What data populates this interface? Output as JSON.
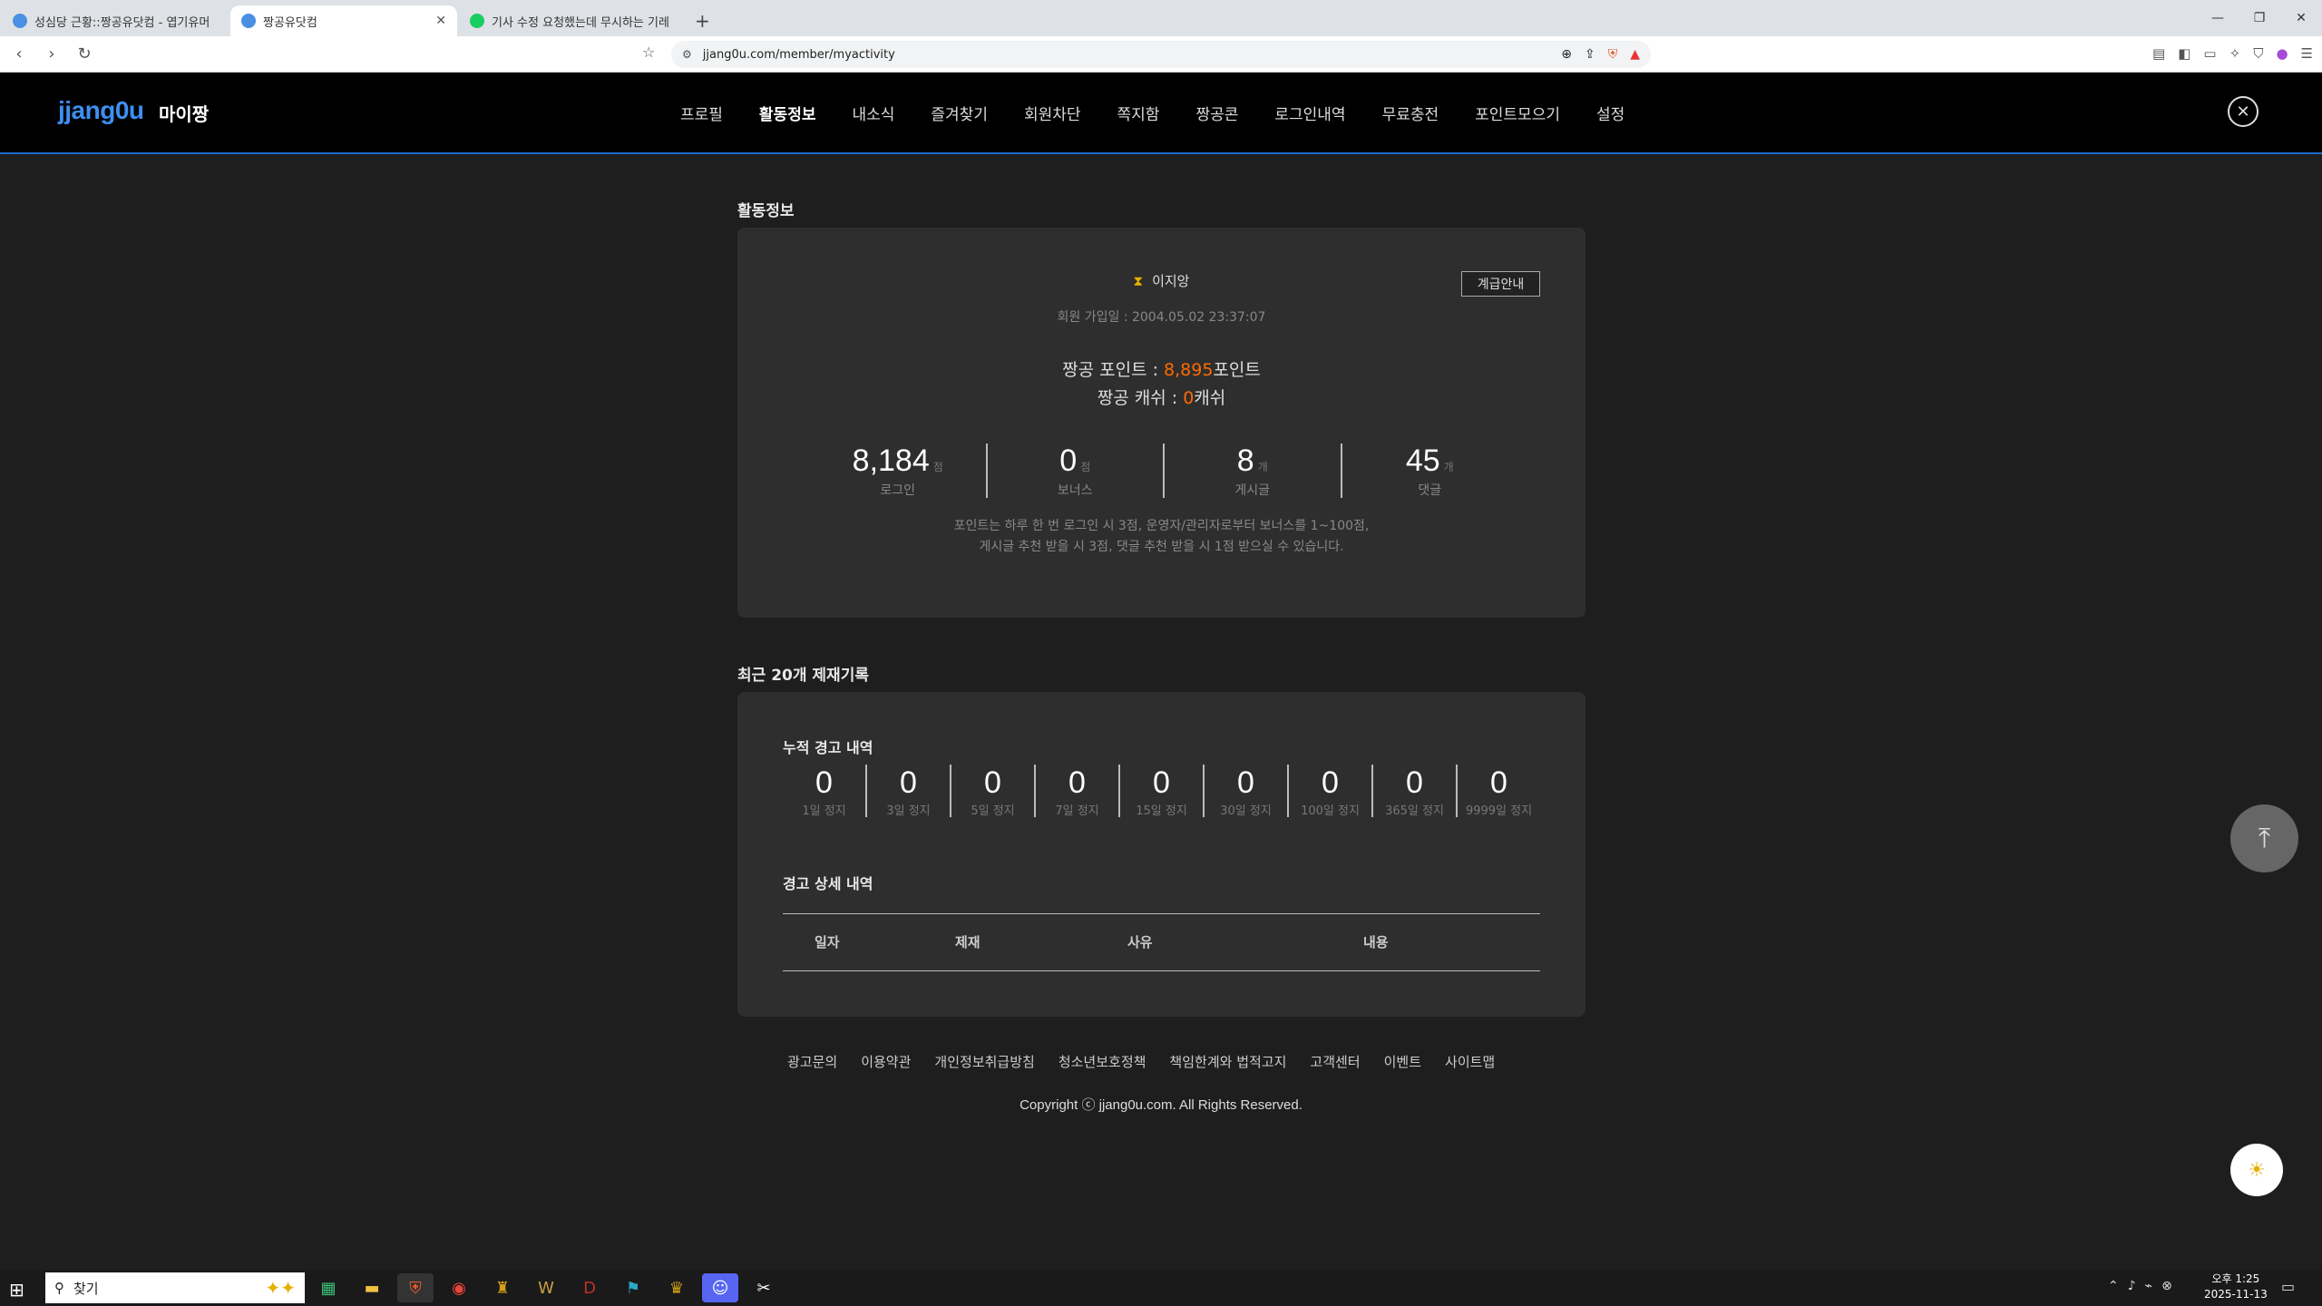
{
  "browser": {
    "tabs": [
      {
        "title": "성심당 근황::짱공유닷컴 - 엽기유머",
        "color": "#4a90e2"
      },
      {
        "title": "짱공유닷컴",
        "color": "#4a90e2"
      },
      {
        "title": "기사 수정 요청했는데 무시하는 기레",
        "color": "#19ce60"
      }
    ],
    "url": "jjang0u.com/member/myactivity"
  },
  "header": {
    "logo": "jjang0u",
    "logo_sub": "마이짱",
    "nav": [
      "프로필",
      "활동정보",
      "내소식",
      "즐겨찾기",
      "회원차단",
      "쪽지함",
      "짱공콘",
      "로그인내역",
      "무료충전",
      "포인트모으기",
      "설정"
    ],
    "active_nav": "활동정보"
  },
  "activity": {
    "section_title": "활동정보",
    "username": "이지앙",
    "grade_button": "계급안내",
    "joined_label": "회원 가입일 : 2004.05.02 23:37:07",
    "points_prefix": "짱공 포인트 : ",
    "points_value": "8,895",
    "points_suffix": "포인트",
    "cash_prefix": "짱공 캐쉬 : ",
    "cash_value": "0",
    "cash_suffix": "캐쉬",
    "stats": [
      {
        "value": "8,184",
        "unit": "점",
        "label": "로그인"
      },
      {
        "value": "0",
        "unit": "점",
        "label": "보너스"
      },
      {
        "value": "8",
        "unit": "개",
        "label": "게시글"
      },
      {
        "value": "45",
        "unit": "개",
        "label": "댓글"
      }
    ],
    "note_line1": "포인트는 하루 한 번 로그인 시 3점, 운영자/관리자로부터 보너스를 1~100점,",
    "note_line2": "게시글 추천 받을 시 3점, 댓글 추천 받을 시 1점 받으실 수 있습니다."
  },
  "sanctions": {
    "section_title": "최근 20개 제재기록",
    "cumulative_title": "누적 경고 내역",
    "warnings": [
      {
        "value": "0",
        "label": "1일 정지"
      },
      {
        "value": "0",
        "label": "3일 정지"
      },
      {
        "value": "0",
        "label": "5일 정지"
      },
      {
        "value": "0",
        "label": "7일 정지"
      },
      {
        "value": "0",
        "label": "15일 정지"
      },
      {
        "value": "0",
        "label": "30일 정지"
      },
      {
        "value": "0",
        "label": "100일 정지"
      },
      {
        "value": "0",
        "label": "365일 정지"
      },
      {
        "value": "0",
        "label": "9999일 정지"
      }
    ],
    "detail_title": "경고 상세 내역",
    "columns": [
      "일자",
      "제재",
      "사유",
      "내용"
    ]
  },
  "footer": {
    "links": [
      "광고문의",
      "이용약관",
      "개인정보취급방침",
      "청소년보호정책",
      "책임한계와 법적고지",
      "고객센터",
      "이벤트",
      "사이트맵"
    ],
    "copyright": "Copyright ⓒ jjang0u.com. All Rights Reserved."
  },
  "taskbar": {
    "search_placeholder": "찾기",
    "time": "오후 1:25",
    "date": "2025-11-13"
  },
  "colors": {
    "accent": "#3d8ff0",
    "point_highlight": "#ff6a00",
    "background": "#1e1e1e",
    "panel": "#2e2e2e"
  }
}
